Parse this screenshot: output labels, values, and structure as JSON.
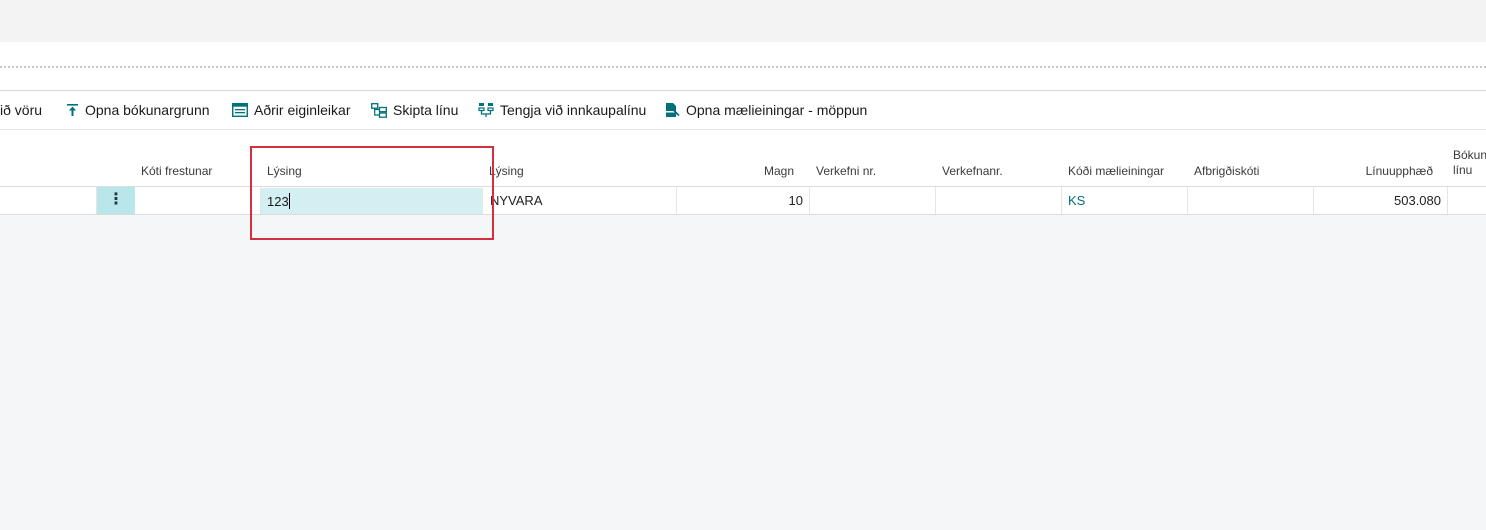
{
  "actions": [
    {
      "label": "ið vöru",
      "icon": "item-icon"
    },
    {
      "label": "Opna bókunargrunn",
      "icon": "pin-up-icon"
    },
    {
      "label": "Aðrir eiginleikar",
      "icon": "properties-icon"
    },
    {
      "label": "Skipta línu",
      "icon": "split-line-icon"
    },
    {
      "label": "Tengja við innkaupalínu",
      "icon": "link-purchase-icon"
    },
    {
      "label": "Opna mælieiningar - möppun",
      "icon": "unit-mapping-icon"
    }
  ],
  "columns": {
    "deferral_code": "Kóti frestunar",
    "description_edit": "Lýsing",
    "description": "Lýsing",
    "quantity": "Magn",
    "project_no": "Verkefni nr.",
    "task_no": "Verkefnanr.",
    "unit_code": "Kóði mælieiningar",
    "variant_code": "Afbrigðiskóti",
    "line_amount": "Línuupphæð",
    "posting_line_1": "Bókun",
    "posting_line_2": "línu"
  },
  "row": {
    "menu": "⋮",
    "deferral_code": "",
    "description_edit": "123",
    "description": "NYVARA",
    "quantity": "10",
    "project_no": "",
    "task_no": "",
    "unit_code": "KS",
    "variant_code": "",
    "line_amount": "503.080",
    "posting": ""
  },
  "colors": {
    "accent": "#00707a",
    "highlight": "#d32f3c",
    "menu_cell": "#b9e6ea",
    "edit_cell": "#d3eff1"
  }
}
